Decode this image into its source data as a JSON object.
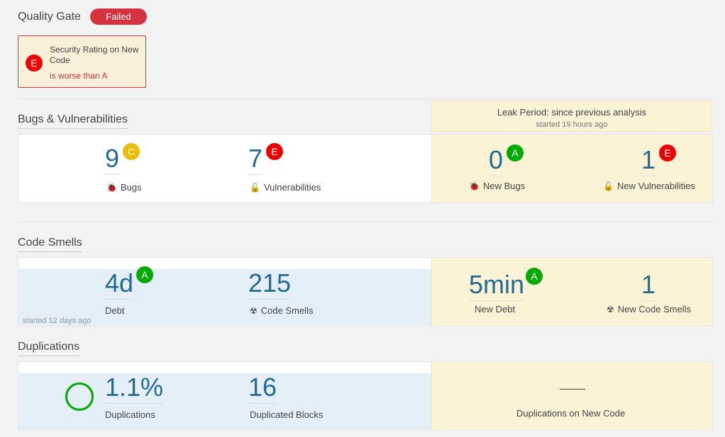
{
  "quality_gate": {
    "title": "Quality Gate",
    "status": "Failed",
    "condition": {
      "rating": "E",
      "metric": "Security Rating on New Code",
      "status_text": "is worse than A"
    }
  },
  "leak_period": {
    "title": "Leak Period: since previous analysis",
    "started": "started 19 hours ago"
  },
  "bugs_vulns": {
    "title": "Bugs & Vulnerabilities",
    "bugs": {
      "value": "9",
      "rating": "C",
      "label": "Bugs",
      "icon": "bug-icon"
    },
    "vulnerabilities": {
      "value": "7",
      "rating": "E",
      "label": "Vulnerabilities",
      "icon": "lock-icon"
    },
    "new_bugs": {
      "value": "0",
      "rating": "A",
      "label": "New Bugs",
      "icon": "bug-icon"
    },
    "new_vulnerabilities": {
      "value": "1",
      "rating": "E",
      "label": "New Vulnerabilities",
      "icon": "lock-icon"
    }
  },
  "code_smells": {
    "title": "Code Smells",
    "debt": {
      "value": "4d",
      "rating": "A",
      "label": "Debt"
    },
    "smells": {
      "value": "215",
      "label": "Code Smells",
      "icon": "radiation-icon"
    },
    "started": "started 12 days ago",
    "new_debt": {
      "value": "5min",
      "rating": "A",
      "label": "New Debt"
    },
    "new_smells": {
      "value": "1",
      "label": "New Code Smells",
      "icon": "radiation-icon"
    }
  },
  "duplications": {
    "title": "Duplications",
    "density": {
      "value": "1.1%",
      "label": "Duplications"
    },
    "blocks": {
      "value": "16",
      "label": "Duplicated Blocks"
    },
    "new_code": {
      "value": "—",
      "label": "Duplications on New Code"
    }
  },
  "colors": {
    "failed": "#d4333f",
    "rating_a": "#00aa00",
    "rating_c": "#eabe06",
    "rating_e": "#ee0000",
    "value_blue": "#236a97",
    "leak_bg": "#fbf3d5"
  }
}
